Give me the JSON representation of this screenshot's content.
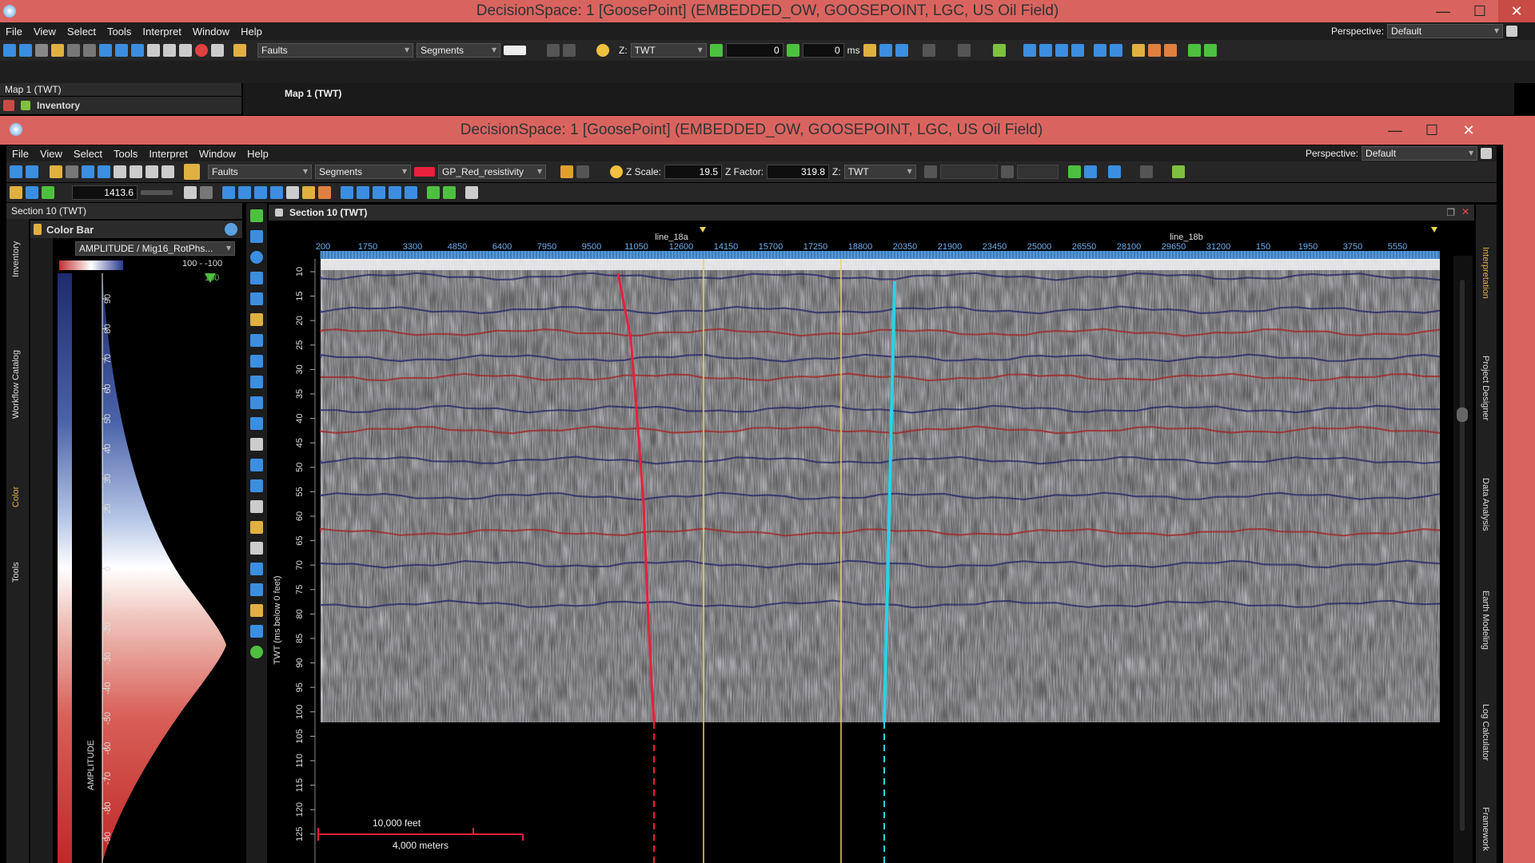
{
  "back_window": {
    "title": "DecisionSpace: 1 [GoosePoint] (EMBEDDED_OW, GOOSEPOINT, LGC, US Oil Field)",
    "menu": [
      "File",
      "View",
      "Select",
      "Tools",
      "Interpret",
      "Window",
      "Help"
    ],
    "perspective_label": "Perspective:",
    "perspective_value": "Default",
    "combo_faults": "Faults",
    "combo_segments": "Segments",
    "z_label": "Z:",
    "z_value": "TWT",
    "time_field_1": "0",
    "time_field_2": "0",
    "ms_unit": "ms",
    "map_panel_title": "Map 1 (TWT)",
    "inventory_tab": "Inventory",
    "map_view_title": "Map 1 (TWT)"
  },
  "front_window": {
    "title": "DecisionSpace: 1 [GoosePoint] (EMBEDDED_OW, GOOSEPOINT, LGC, US Oil Field)",
    "menu": [
      "File",
      "View",
      "Select",
      "Tools",
      "Interpret",
      "Window",
      "Help"
    ],
    "perspective_label": "Perspective:",
    "perspective_value": "Default",
    "combo_faults": "Faults",
    "combo_segments": "Segments",
    "property_value": "GP_Red_resistivity",
    "z_scale_label": "Z Scale:",
    "z_scale_value": "19.5",
    "z_factor_label": "Z Factor:",
    "z_factor_value": "319.8",
    "z_label": "Z:",
    "z_value": "TWT",
    "depth_field": "1413.6",
    "left_panel_title": "Section 10 (TWT)",
    "colorbar_title": "Color Bar",
    "colorbar_attr": "AMPLITUDE / Mig16_RotPhs...",
    "colorbar_range": "100 - -100",
    "colorbar_top_value": "100",
    "colorbar_axis_label": "AMPLITUDE",
    "colorbar_ticks": [
      "90",
      "80",
      "70",
      "60",
      "50",
      "40",
      "30",
      "20",
      "10",
      "0",
      "-10",
      "-20",
      "-30",
      "-40",
      "-50",
      "-60",
      "-70",
      "-80",
      "-90"
    ],
    "left_vtabs": [
      "Inventory",
      "Workflow Catalog",
      "Color",
      "Tools"
    ],
    "section_title": "Section 10 (TWT)",
    "right_tabs": [
      "Interpretation",
      "Project Designer",
      "Data Analysis",
      "Earth Modeling",
      "Log Calculator",
      "Framework"
    ]
  },
  "section": {
    "line_labels": [
      "line_18a",
      "line_18b"
    ],
    "top_ticks": [
      "200",
      "1750",
      "3300",
      "4850",
      "6400",
      "7950",
      "9500",
      "11050",
      "12600",
      "14150",
      "15700",
      "17250",
      "18800",
      "20350",
      "21900",
      "23450",
      "25000",
      "26550",
      "28100",
      "29650",
      "31200",
      "150",
      "1950",
      "3750",
      "5550"
    ],
    "y_axis_label": "TWT (ms below 0 feet)",
    "y_ticks": [
      "10",
      "15",
      "20",
      "25",
      "30",
      "35",
      "40",
      "45",
      "50",
      "55",
      "60",
      "65",
      "70",
      "75",
      "80",
      "85",
      "90",
      "95",
      "100",
      "105",
      "110",
      "115",
      "120",
      "125"
    ],
    "scale_feet": "10,000 feet",
    "scale_meters": "4,000 meters",
    "colors": {
      "fault": "#e8203c",
      "well_yellow": "#e8d84a",
      "well_cyan": "#27d4e6",
      "titlebar": "#d9645f"
    }
  }
}
